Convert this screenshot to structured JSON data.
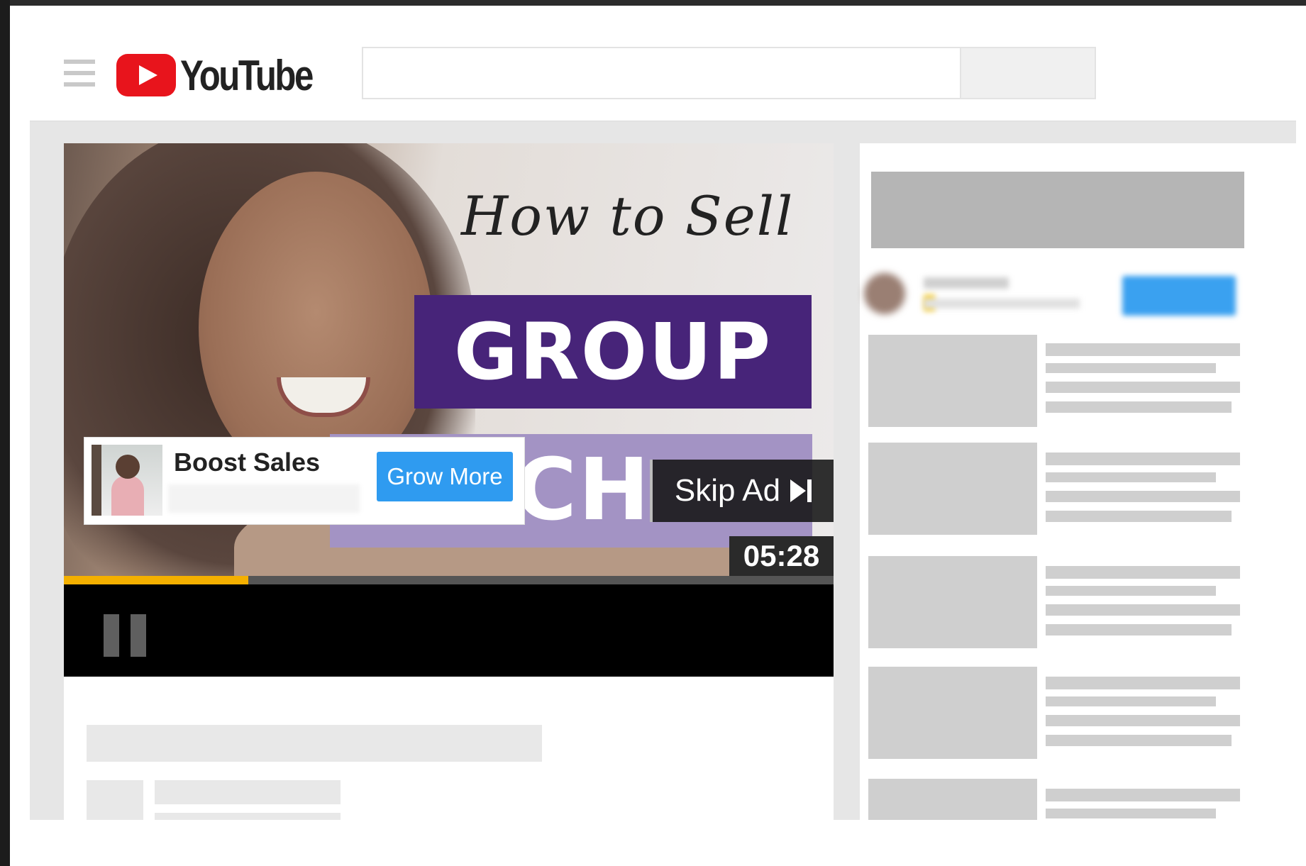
{
  "app": {
    "name": "YouTube",
    "brand_color": "#e8141c",
    "icons": {
      "menu": "hamburger-menu-icon",
      "logo": "youtube-play-icon",
      "pause": "pause-icon",
      "skip": "skip-next-icon"
    }
  },
  "search": {
    "value": "",
    "placeholder": ""
  },
  "video": {
    "title_line1": "How to Sell",
    "title_line2": "GROUP",
    "title_line3": "CH",
    "banner_color": "#472479",
    "progress_fraction": 0.24,
    "progress_color": "#f4b000"
  },
  "ad": {
    "title": "Boost Sales",
    "cta_label": "Grow More",
    "cta_color": "#2f9bf0",
    "skip_label": "Skip Ad",
    "countdown": "05:28"
  }
}
